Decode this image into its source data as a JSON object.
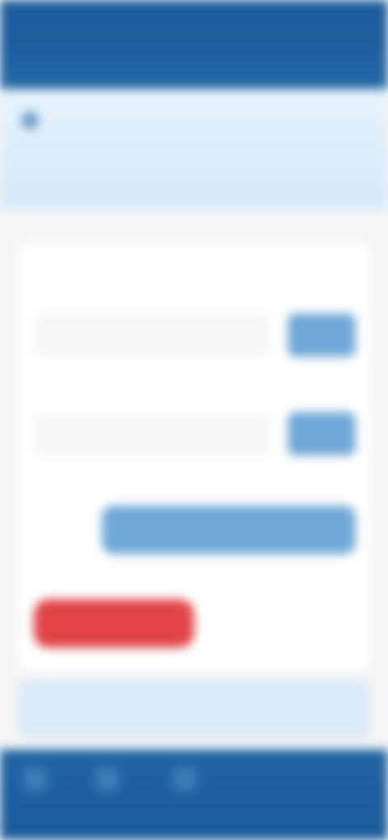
{
  "status_bar": {
    "time": "",
    "indicators": ""
  },
  "appbar": {
    "title": ""
  },
  "banner": {
    "text": "",
    "link": ""
  },
  "card": {
    "section_label_1": "",
    "section_label_2": "",
    "section_label_3": "",
    "field_1": {
      "value": "",
      "button": ""
    },
    "field_2": {
      "value": "",
      "button": ""
    },
    "wide_button": "",
    "note": "",
    "danger_button": "",
    "ghost_button": ""
  },
  "bottom_banner": {
    "text": ""
  },
  "colors": {
    "primary": "#1d5f9c",
    "primary_light": "#6fa8d8",
    "danger": "#e04446",
    "banner_bg": "#dcebf8"
  }
}
